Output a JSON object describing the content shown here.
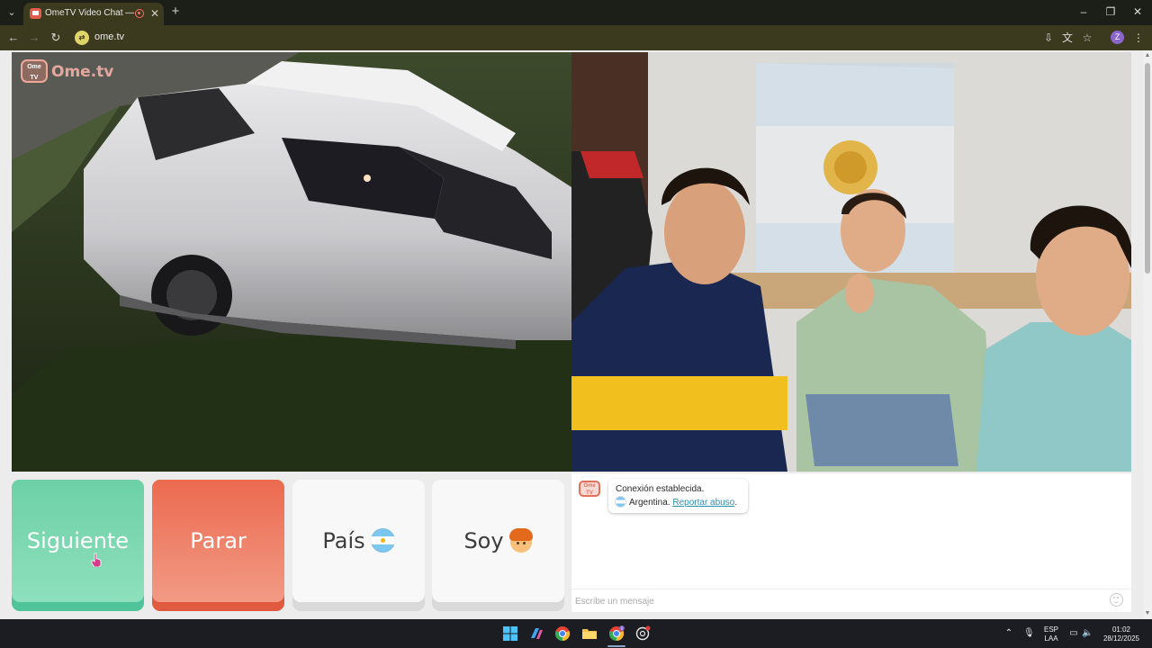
{
  "browser": {
    "tab_title": "OmeTV Video Chat — Ome",
    "tab_close": "✕",
    "new_tab": "+",
    "url": "ome.tv",
    "profile_initial": "Z"
  },
  "page": {
    "logo": {
      "badge_line1": "Ome",
      "badge_line2": "TV",
      "text": "Ome.tv"
    },
    "controls": {
      "next_label": "Siguiente",
      "stop_label": "Parar",
      "country_label": "País",
      "gender_label": "Soy"
    },
    "chat": {
      "avatar_line1": "Ome",
      "avatar_line2": "TV",
      "status_message": "Conexión establecida.",
      "country_text": "Argentina.",
      "report_link": "Reportar abuso",
      "report_suffix": ".",
      "input_placeholder": "Escribe un mensaje"
    }
  },
  "taskbar": {
    "chrome_badge": "2",
    "language_line1": "ESP",
    "language_line2": "LAA",
    "time": "01:02",
    "date": "28/12/2025"
  },
  "colors": {
    "next_button": "#6dd0a6",
    "stop_button": "#eb6a4f",
    "report_link": "#2a8fb0",
    "brand_logo": "#f4b0a6"
  },
  "icons": {
    "country_button": "argentina-flag-icon",
    "gender_button": "boy-emoji-icon",
    "chat_emoji": "smiley-icon"
  }
}
